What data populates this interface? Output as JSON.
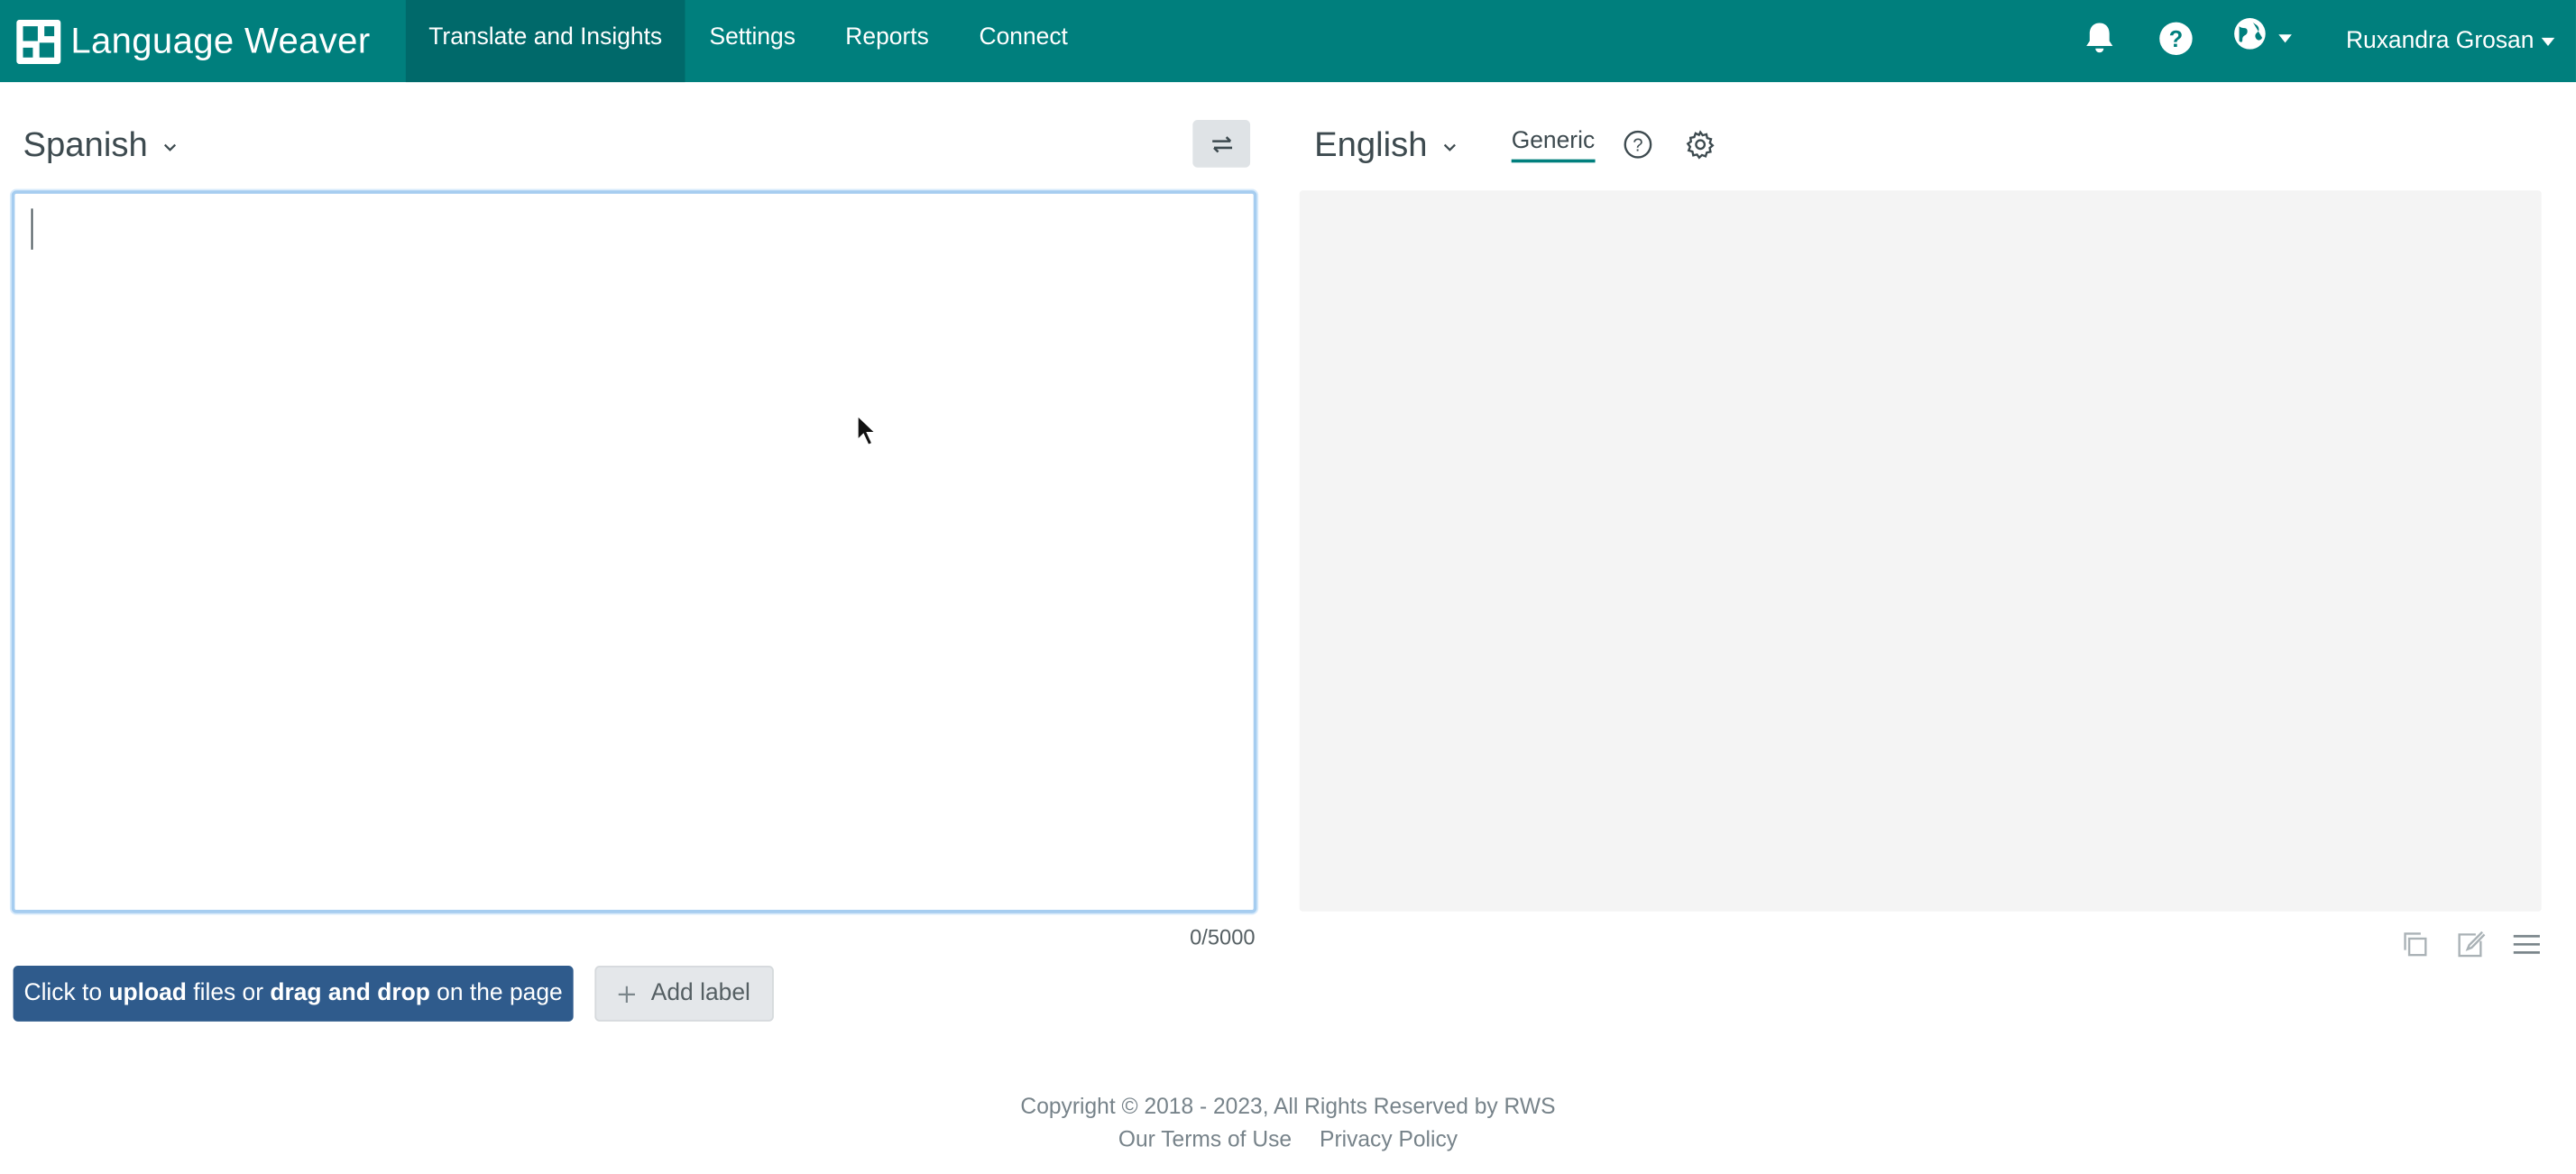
{
  "app": {
    "brand": "Language Weaver"
  },
  "nav": {
    "items": [
      {
        "label": "Translate and Insights",
        "active": true
      },
      {
        "label": "Settings"
      },
      {
        "label": "Reports"
      },
      {
        "label": "Connect"
      }
    ],
    "icons": [
      "bell-icon",
      "help-icon",
      "globe-icon"
    ],
    "user": "Ruxandra Grosan"
  },
  "source": {
    "language": "Spanish",
    "text": "",
    "char_count": "0/5000"
  },
  "target": {
    "language": "English",
    "model": "Generic",
    "text": ""
  },
  "actions": {
    "upload": {
      "prefix": "Click to",
      "bold1": "upload",
      "mid": "files or",
      "bold2": "drag and drop",
      "suffix": "on the page"
    },
    "add_label": "Add label"
  },
  "target_tools": [
    "copy-icon",
    "edit-icon",
    "menu-icon"
  ],
  "footer": {
    "copyright": "Copyright © 2018 - 2023, All Rights Reserved by RWS",
    "terms": "Our Terms of Use",
    "privacy": "Privacy Policy"
  },
  "colors": {
    "header_bg": "#007f7d",
    "header_active_bg": "#00696a",
    "primary_button": "#2f5b8c",
    "source_border": "#a6cdf0",
    "target_bg": "#f4f4f4",
    "tab_underline": "#007f7d"
  }
}
